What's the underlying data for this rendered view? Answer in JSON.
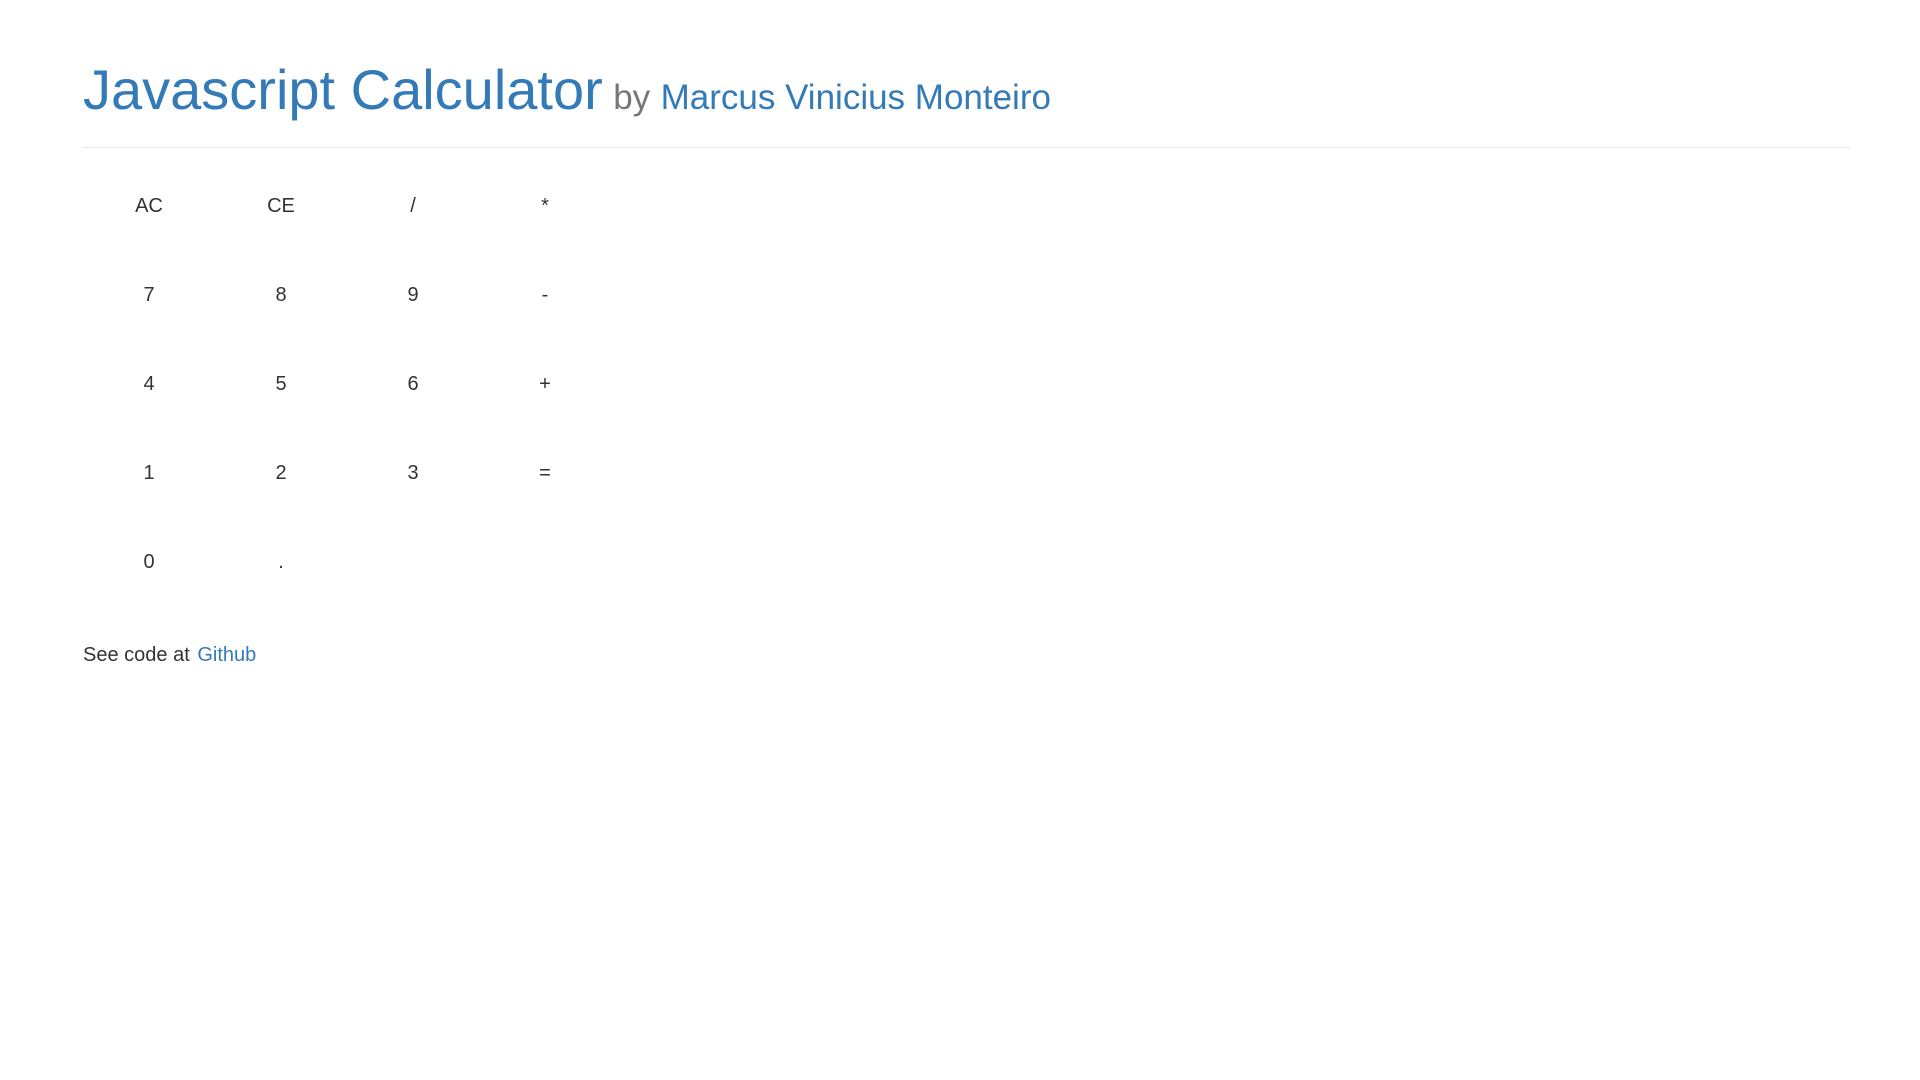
{
  "header": {
    "title": "Javascript Calculator",
    "by_label": "by",
    "author": "Marcus Vinicius Monteiro"
  },
  "keypad": {
    "rows": [
      [
        "AC",
        "CE",
        "/",
        "*"
      ],
      [
        "7",
        "8",
        "9",
        "-"
      ],
      [
        "4",
        "5",
        "6",
        "+"
      ],
      [
        "1",
        "2",
        "3",
        "="
      ],
      [
        "0",
        "."
      ]
    ]
  },
  "footer": {
    "text": "See code at",
    "link_label": "Github"
  },
  "colors": {
    "link": "#337ab7",
    "text": "#333333",
    "muted": "#777777",
    "divider": "#e8e8e8"
  }
}
